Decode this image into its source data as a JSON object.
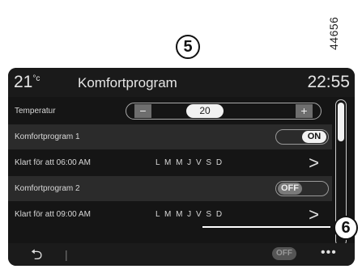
{
  "document_id": "44656",
  "callouts": {
    "temperature_marker": "5",
    "days_marker": "6"
  },
  "header": {
    "outside_temp": "21",
    "temp_unit": "°c",
    "title": "Komfortprogram",
    "time": "22:55"
  },
  "temperature_row": {
    "label": "Temperatur",
    "minus": "−",
    "value": "20",
    "plus": "+"
  },
  "rows": [
    {
      "label": "Komfortprogram 1",
      "toggle": "ON"
    },
    {
      "label": "Klart för att  06:00 AM",
      "days": "L M M J V S D",
      "chevron": ">"
    },
    {
      "label": "Komfortprogram 2",
      "toggle": "OFF"
    },
    {
      "label": "Klart för att  09:00 AM",
      "days": "L M M J V S D",
      "chevron": ">"
    }
  ],
  "bottom_bar": {
    "back_glyph": "⮌",
    "separator": "|",
    "toggle": "OFF",
    "more": "•••"
  }
}
